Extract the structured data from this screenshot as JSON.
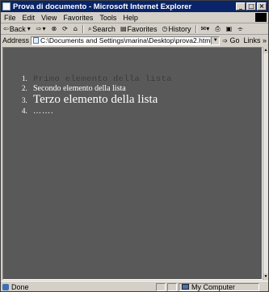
{
  "window": {
    "title": "Prova di documento - Microsoft Internet Explorer"
  },
  "menubar": {
    "items": [
      "File",
      "Edit",
      "View",
      "Favorites",
      "Tools",
      "Help"
    ]
  },
  "toolbar": {
    "back": "Back",
    "search": "Search",
    "favorites": "Favorites",
    "history": "History"
  },
  "address": {
    "label": "Address",
    "value": "C:\\Documents and Settings\\marina\\Desktop\\prova2.html",
    "go": "Go",
    "links": "Links"
  },
  "list": {
    "items": [
      {
        "num": "1.",
        "text": "Primo elemento della lista"
      },
      {
        "num": "2.",
        "text": "Secondo elemento della lista"
      },
      {
        "num": "3.",
        "text": "Terzo elemento della lista"
      },
      {
        "num": "4.",
        "text": "……."
      }
    ]
  },
  "status": {
    "text": "Done",
    "zone": "My Computer"
  },
  "colors": {
    "titlebar": "#0a246a",
    "page_background": "#595959",
    "chrome": "#d4d0c8"
  }
}
